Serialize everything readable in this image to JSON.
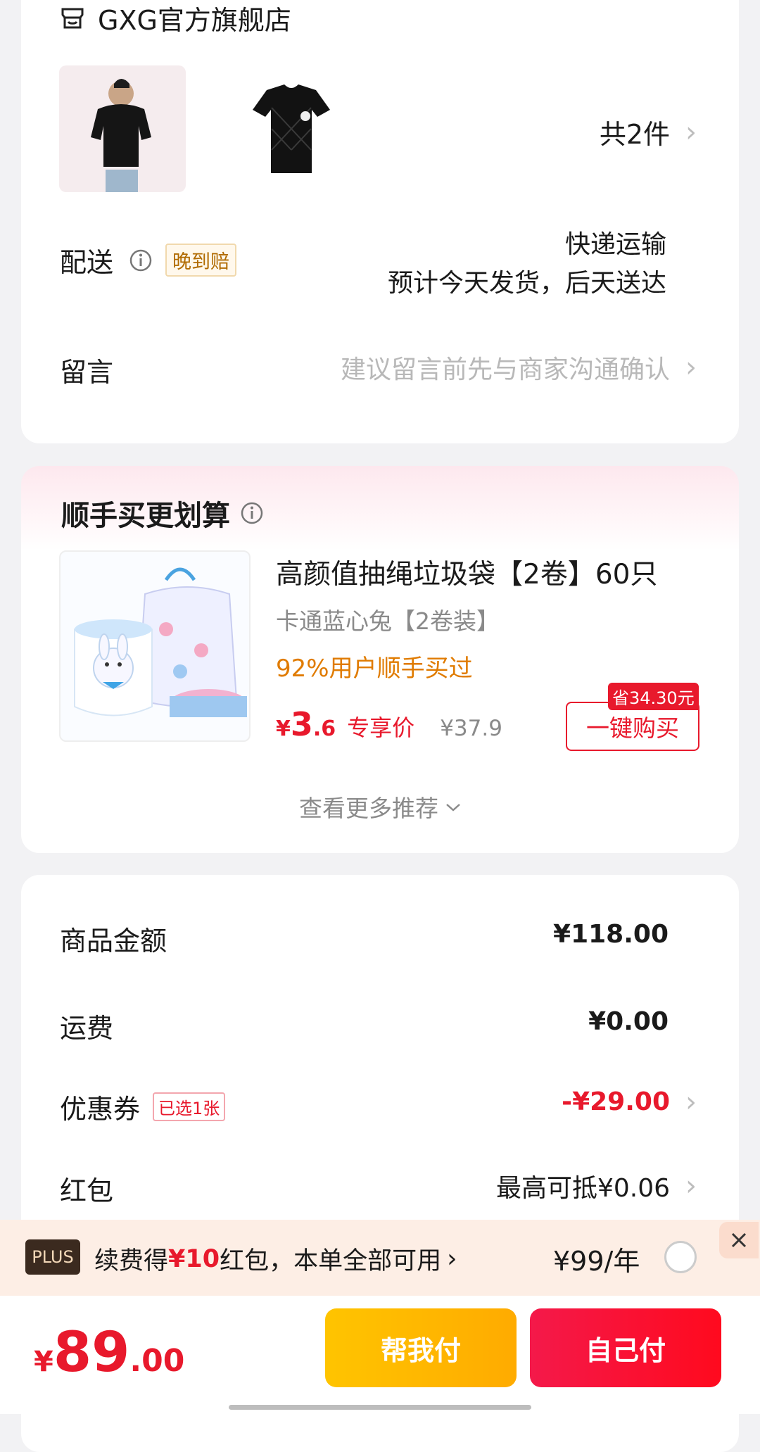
{
  "store": {
    "name": "GXG官方旗舰店",
    "item_count_label": "共2件",
    "delivery": {
      "label": "配送",
      "badge": "晚到赔",
      "method": "快递运输",
      "estimate": "预计今天发货，后天送达"
    },
    "message": {
      "label": "留言",
      "placeholder": "建议留言前先与商家沟通确认"
    }
  },
  "recommend": {
    "title": "顺手买更划算",
    "product": {
      "title": "高颜值抽绳垃圾袋【2卷】60只",
      "variant": "卡通蓝心兔【2卷装】",
      "social": "92%用户顺手买过",
      "price_symbol": "¥",
      "price_int": "3",
      "price_dec": ".6",
      "price_tag": "专享价",
      "original_price": "¥37.9",
      "save_badge": "省34.30元",
      "buy_button": "一键购买"
    },
    "more": "查看更多推荐"
  },
  "summary": {
    "rows": [
      {
        "label": "商品金额",
        "value": "¥118.00"
      },
      {
        "label": "运费",
        "value": "¥0.00"
      },
      {
        "label": "优惠券",
        "badge": "已选1张",
        "value": "-¥29.00"
      },
      {
        "label": "红包",
        "value": "最高可抵¥0.06"
      }
    ]
  },
  "plus_banner": {
    "badge": "PLUS",
    "text_prefix": "续费得",
    "text_highlight": "¥10",
    "text_suffix": "红包，本单全部可用",
    "price": "¥99/年"
  },
  "footer": {
    "total_symbol": "¥",
    "total_int": "89",
    "total_dec": ".00",
    "help_pay": "帮我付",
    "self_pay": "自己付"
  },
  "colors": {
    "accent_red": "#e8192c",
    "orange": "#e07b00",
    "help_pay_bg": "#ffb300",
    "self_pay_bg": "#f5193a",
    "banner_bg": "#fdeee5"
  },
  "icons": [
    "store-icon",
    "info-icon",
    "chevron-right-icon",
    "chevron-down-icon",
    "close-icon",
    "radio-empty-icon"
  ]
}
